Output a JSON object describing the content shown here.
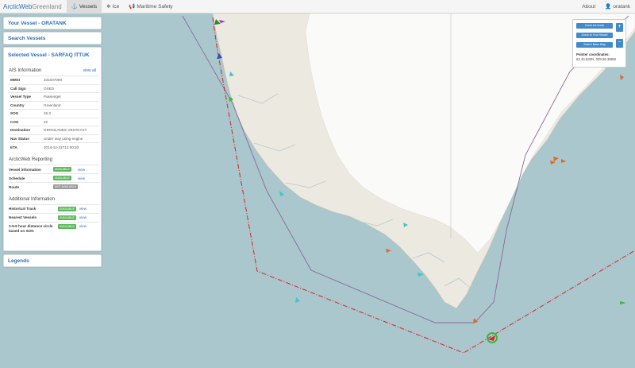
{
  "navbar": {
    "brand_part1": "ArcticWeb",
    "brand_part2": "Greenland",
    "items": [
      {
        "icon": "anchor-icon",
        "glyph": "⚓",
        "label": "Vessels"
      },
      {
        "icon": "snowflake-icon",
        "glyph": "❄",
        "label": "Ice"
      },
      {
        "icon": "bullhorn-icon",
        "glyph": "📢",
        "label": "Maritime Safety"
      }
    ],
    "about": "About",
    "user_glyph": "👤",
    "user": "oratank"
  },
  "left_panel": {
    "your_vessel": "Your Vessel - ORATANK",
    "search_vessels": "Search Vessels",
    "selected_vessel": "Selected Vessel - SARFAQ ITTUK",
    "ais_title": "AIS Information",
    "view_all": "view all",
    "ais_rows": [
      {
        "k": "MMSI",
        "v": "331037000"
      },
      {
        "k": "Call Sign",
        "v": "OXED"
      },
      {
        "k": "Vessel Type",
        "v": "Passenger"
      },
      {
        "k": "Country",
        "v": "Greenland"
      },
      {
        "k": "SOG",
        "v": "15.3"
      },
      {
        "k": "COG",
        "v": "22"
      },
      {
        "k": "Destination",
        "v": "GRONLANDS VESTKYST"
      },
      {
        "k": "Nav Status",
        "v": "Under way using engine"
      },
      {
        "k": "ETA",
        "v": "2014-12-31T12:00:20"
      }
    ],
    "reporting_title": "ArcticWeb Reporting",
    "reporting_rows": [
      {
        "k": "Vessel Information",
        "badge": "AVAILABLE",
        "view": "view"
      },
      {
        "k": "Schedule",
        "badge": "AVAILABLE",
        "view": "view"
      },
      {
        "k": "Route",
        "badge": "NOT AVAILABLE",
        "view": ""
      }
    ],
    "additional_title": "Additional Information",
    "additional_rows": [
      {
        "k": "Historical Track",
        "badge": "AVAILABLE",
        "view": "view"
      },
      {
        "k": "Nearest Vessels",
        "badge": "AVAILABLE",
        "view": "view"
      },
      {
        "k": "3-6-9 hour distance circle based on SOG",
        "badge": "AVAILABLE",
        "view": "view"
      }
    ],
    "legends": "Legends"
  },
  "map_controls": {
    "zoom_arctic": "Zoom Art Arctic",
    "zoom_vessel": "Zoom to Your Vessel",
    "switch_base": "Switch Base Map",
    "zoom_in": "+",
    "zoom_out": "−",
    "pointer_label": "Pointer coordinates:",
    "pointer_value": "63 44.532N, 039 56.386W"
  },
  "colors": {
    "sea": "#a9c7cc",
    "land": "#ece9e1",
    "ice": "#fafaf8",
    "brand": "#2a6db5",
    "available": "#5cb85c",
    "not_available": "#999999",
    "button": "#428bca"
  }
}
